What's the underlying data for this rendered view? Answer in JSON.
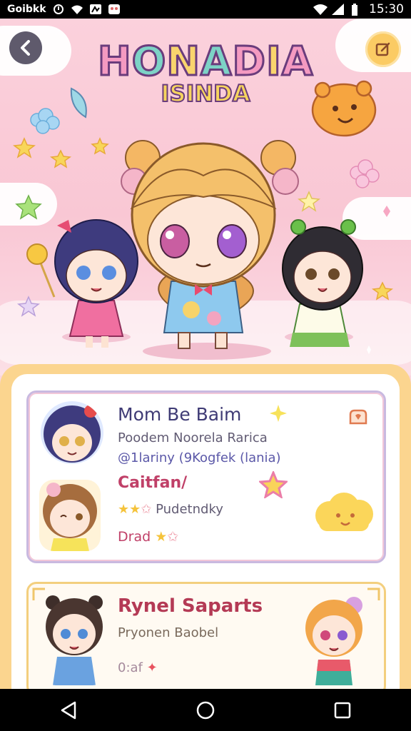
{
  "status_bar": {
    "carrier": "Goibkk",
    "time": "15:30"
  },
  "header": {
    "title_letters": [
      "H",
      "O",
      "N",
      "A",
      "D",
      "I",
      "A"
    ],
    "subtitle": "ISINDA"
  },
  "card_primary": {
    "name": "Mom Be Baim",
    "description": "Poodem Noorela Rarica",
    "tags": "@1lariny (9Kogfek (lania)",
    "section_label": "Caitfan/",
    "rating_label": "Pudetndky",
    "rating_value": 2,
    "rating_max": 3,
    "footer_label": "Drad"
  },
  "card_secondary": {
    "name": "Rynel Saparts",
    "description": "Pryonen Baobel",
    "tag_label": "0:af"
  },
  "icons": {
    "back": "chevron-left-icon",
    "edit": "edit-square-icon",
    "card_action": "heart-badge-icon"
  },
  "colors": {
    "accent_pink": "#f49ac1",
    "accent_gold": "#fbcb64",
    "title_name_primary": "#3f3b75",
    "title_name_secondary": "#b43a55"
  }
}
